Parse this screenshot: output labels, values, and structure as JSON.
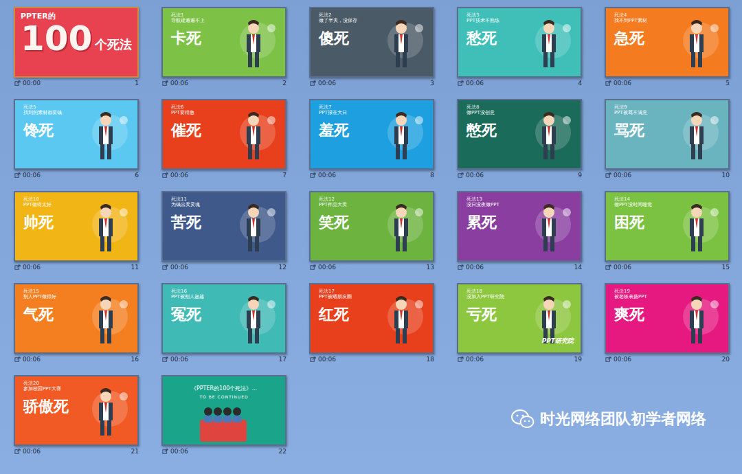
{
  "slides": [
    {
      "number": "1",
      "time": "00:00",
      "selected": true,
      "kind": "cover",
      "color": "#e8414f",
      "eyebrow": "PPTER的",
      "big": "100",
      "title": "个死法"
    },
    {
      "number": "2",
      "time": "00:06",
      "selected": false,
      "kind": "chapter",
      "color": "#7dc146",
      "label": "死法1",
      "subtitle": "导航建遍遍不上",
      "title": "卡死"
    },
    {
      "number": "3",
      "time": "00:06",
      "selected": false,
      "kind": "chapter",
      "color": "#4a5a66",
      "label": "死法2",
      "subtitle": "做了半天，没保存",
      "title": "傻死"
    },
    {
      "number": "4",
      "time": "00:06",
      "selected": false,
      "kind": "chapter",
      "color": "#3fbfb8",
      "label": "死法3",
      "subtitle": "PPT技术不熟练",
      "title": "愁死"
    },
    {
      "number": "5",
      "time": "00:06",
      "selected": false,
      "kind": "chapter",
      "color": "#f47b20",
      "label": "死法4",
      "subtitle": "找不到PPT素材",
      "title": "急死"
    },
    {
      "number": "6",
      "time": "00:06",
      "selected": false,
      "kind": "chapter",
      "color": "#5bc8f2",
      "label": "死法5",
      "subtitle": "找到的素材都要钱",
      "title": "馋死"
    },
    {
      "number": "7",
      "time": "00:06",
      "selected": false,
      "kind": "chapter",
      "color": "#e8401c",
      "label": "死法6",
      "subtitle": "PPT要得急",
      "title": "催死"
    },
    {
      "number": "8",
      "time": "00:06",
      "selected": false,
      "kind": "chapter",
      "color": "#1ea0e0",
      "label": "死法7",
      "subtitle": "PPT报在大日",
      "title": "羞死"
    },
    {
      "number": "9",
      "time": "00:06",
      "selected": false,
      "kind": "chapter",
      "color": "#1a6b5a",
      "label": "死法8",
      "subtitle": "做PPT没创意",
      "title": "憋死"
    },
    {
      "number": "10",
      "time": "00:06",
      "selected": false,
      "kind": "chapter",
      "color": "#6ab4c0",
      "label": "死法9",
      "subtitle": "PPT被骂不满意",
      "title": "骂死"
    },
    {
      "number": "11",
      "time": "00:06",
      "selected": false,
      "kind": "chapter",
      "color": "#f2b516",
      "label": "死法10",
      "subtitle": "PPT做得太好",
      "title": "帅死"
    },
    {
      "number": "12",
      "time": "00:06",
      "selected": false,
      "kind": "chapter",
      "color": "#3f5a8a",
      "label": "死法11",
      "subtitle": "为钱出卖灵魂",
      "title": "苦死"
    },
    {
      "number": "13",
      "time": "00:06",
      "selected": false,
      "kind": "chapter",
      "color": "#6cb33f",
      "label": "死法12",
      "subtitle": "PPT作品大卖",
      "title": "笑死"
    },
    {
      "number": "14",
      "time": "00:06",
      "selected": false,
      "kind": "chapter",
      "color": "#8a3fa0",
      "label": "死法13",
      "subtitle": "没日没夜做PPT",
      "title": "累死"
    },
    {
      "number": "15",
      "time": "00:06",
      "selected": false,
      "kind": "chapter",
      "color": "#7cc242",
      "label": "死法14",
      "subtitle": "做PPT没时间睡觉",
      "title": "困死"
    },
    {
      "number": "16",
      "time": "00:06",
      "selected": false,
      "kind": "chapter",
      "color": "#f47f20",
      "label": "死法15",
      "subtitle": "别人PPT做得好",
      "title": "气死"
    },
    {
      "number": "17",
      "time": "00:06",
      "selected": false,
      "kind": "chapter",
      "color": "#3fbab5",
      "label": "死法16",
      "subtitle": "PPT被别人超越",
      "title": "冤死"
    },
    {
      "number": "18",
      "time": "00:06",
      "selected": false,
      "kind": "chapter",
      "color": "#e8401c",
      "label": "死法17",
      "subtitle": "PPT被晒朋友圈",
      "title": "红死"
    },
    {
      "number": "19",
      "time": "00:06",
      "selected": false,
      "kind": "chapter",
      "color": "#8dc63f",
      "label": "死法18",
      "subtitle": "没加入PPT研究院",
      "title": "亏死",
      "badge": "PPT研究院"
    },
    {
      "number": "20",
      "time": "00:06",
      "selected": false,
      "kind": "chapter",
      "color": "#e5197f",
      "label": "死法19",
      "subtitle": "被老板表扬PPT",
      "title": "爽死"
    },
    {
      "number": "21",
      "time": "00:06",
      "selected": false,
      "kind": "chapter",
      "color": "#f15a24",
      "label": "死法20",
      "subtitle": "参加校园PPT大赛",
      "title": "骄傲死"
    },
    {
      "number": "22",
      "time": "00:06",
      "selected": false,
      "kind": "end",
      "color": "#1aa58a",
      "title": "《PPTER的100个死法》...",
      "subtitle": "TO BE CONTINUED"
    }
  ],
  "watermark": {
    "text": "时光网络团队初学者网络"
  }
}
